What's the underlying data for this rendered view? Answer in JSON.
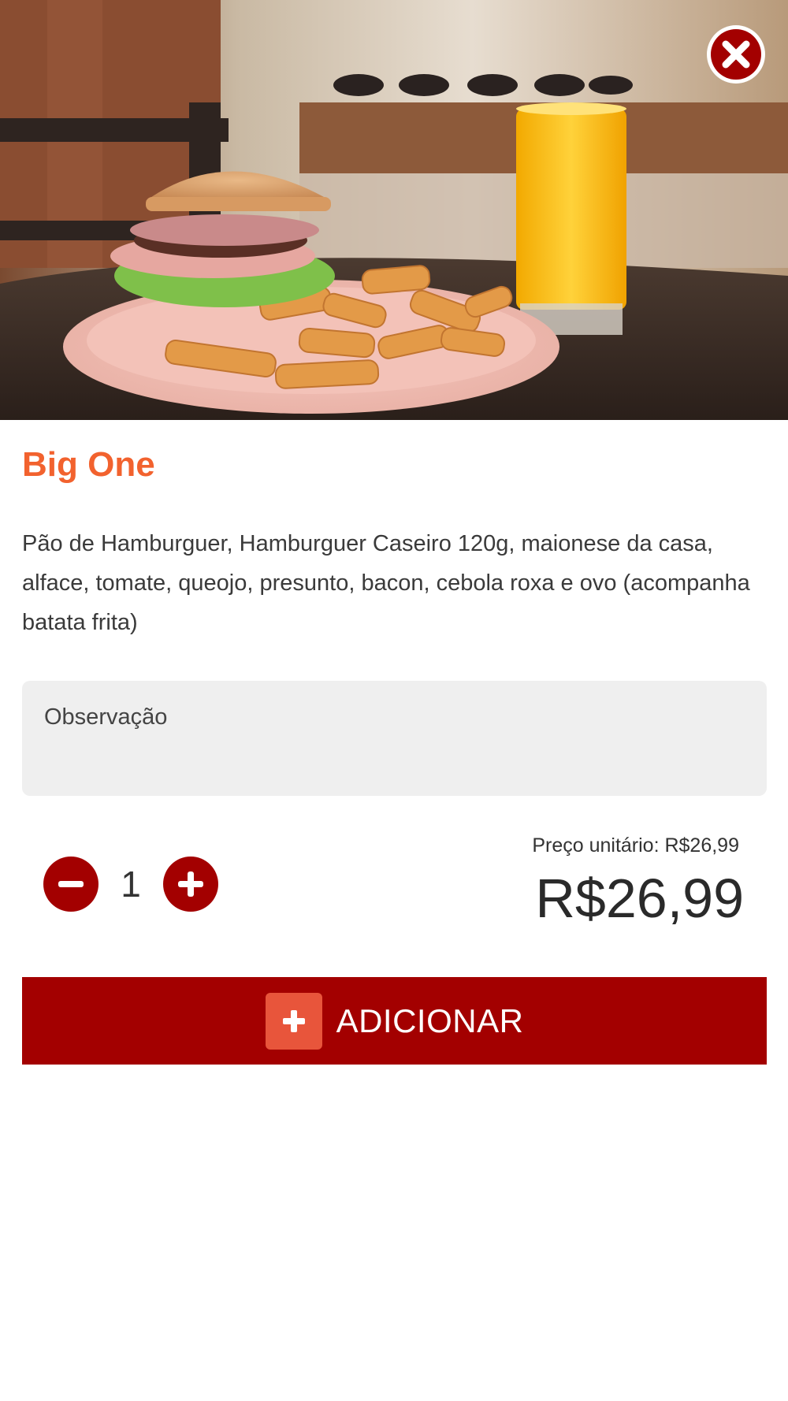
{
  "product": {
    "name": "Big One",
    "description": "Pão de Hamburguer, Hamburguer Caseiro 120g, maionese da casa, alface, tomate, queojo, presunto, bacon, cebola roxa e ovo (acompanha batata frita)",
    "image_icon": "burger-fries-juice-photo"
  },
  "observation": {
    "placeholder": "Observação",
    "value": ""
  },
  "quantity": {
    "value": "1",
    "decrement_icon": "minus-icon",
    "increment_icon": "plus-icon"
  },
  "pricing": {
    "unit_price_label": "Preço unitário: R$26,99",
    "total_price": "R$26,99"
  },
  "actions": {
    "add_label": "ADICIONAR",
    "add_icon": "plus-square-icon",
    "close_icon": "close-icon"
  },
  "colors": {
    "accent_red": "#a30000",
    "title_orange": "#f2622e",
    "add_icon_bg": "#e8553b",
    "field_bg": "#efefef"
  }
}
